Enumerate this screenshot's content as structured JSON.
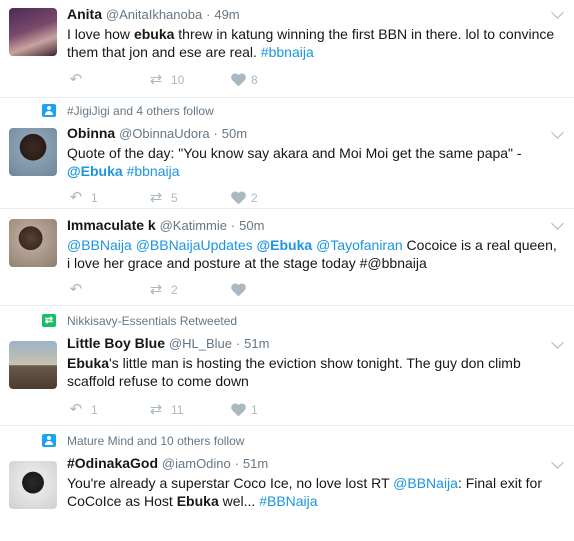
{
  "tweets": [
    {
      "name": "Anita",
      "handle": "@AnitaIkhanoba",
      "time": "49m",
      "text_parts": [
        "I love how ",
        "ebuka",
        " threw in katung winning the first BBN in there. lol to convince them that jon and ese are real. ",
        "#bbnaija"
      ],
      "reply_count": "",
      "retweet_count": "10",
      "like_count": "8"
    },
    {
      "context": "#JigiJigi and 4 others follow",
      "name": "Obinna",
      "handle": "@ObinnaUdora",
      "time": "50m",
      "text_parts": [
        "Quote of the day: \"You know say akara and Moi Moi get the same papa\" - ",
        "@Ebuka",
        " ",
        "#bbnaija"
      ],
      "reply_count": "1",
      "retweet_count": "5",
      "like_count": "2"
    },
    {
      "name": "Immaculate k",
      "handle": "@Katimmie",
      "time": "50m",
      "text_parts": [
        "@BBNaija",
        " ",
        "@BBNaijaUpdates",
        " ",
        "@Ebuka",
        " ",
        "@Tayofaniran",
        "  Cocoice is a real queen, i love her grace and posture at the stage today #@bbnaija"
      ],
      "reply_count": "",
      "retweet_count": "2",
      "like_count": ""
    },
    {
      "context": "Nikkisavy-Essentials Retweeted",
      "name": "Little Boy Blue",
      "handle": "@HL_Blue",
      "time": "51m",
      "text_parts": [
        "Ebuka",
        "'s little man is hosting the eviction show tonight. The guy don climb scaffold refuse to come down"
      ],
      "reply_count": "1",
      "retweet_count": "11",
      "like_count": "1"
    },
    {
      "context": "Mature Mind and 10 others follow",
      "name": "#OdinakaGod",
      "handle": "@iamOdino",
      "time": "51m",
      "text_parts": [
        "You're already a superstar Coco Ice, no love lost RT ",
        "@BBNaija",
        ": Final exit for CoCoIce as Host ",
        "Ebuka",
        " wel... ",
        "#BBNaija"
      ]
    }
  ],
  "icons": {
    "reply": "reply-arrow-icon",
    "retweet": "retweet-icon",
    "like": "heart-icon",
    "more": "chevron-down-icon",
    "follow": "user-follow-icon",
    "retweeted": "retweet-context-icon"
  },
  "colors": {
    "link": "#1b95e0",
    "muted": "#657786",
    "action": "#aab8c2",
    "follow_badge": "#1da1f2",
    "retweet_badge": "#17bf63"
  }
}
